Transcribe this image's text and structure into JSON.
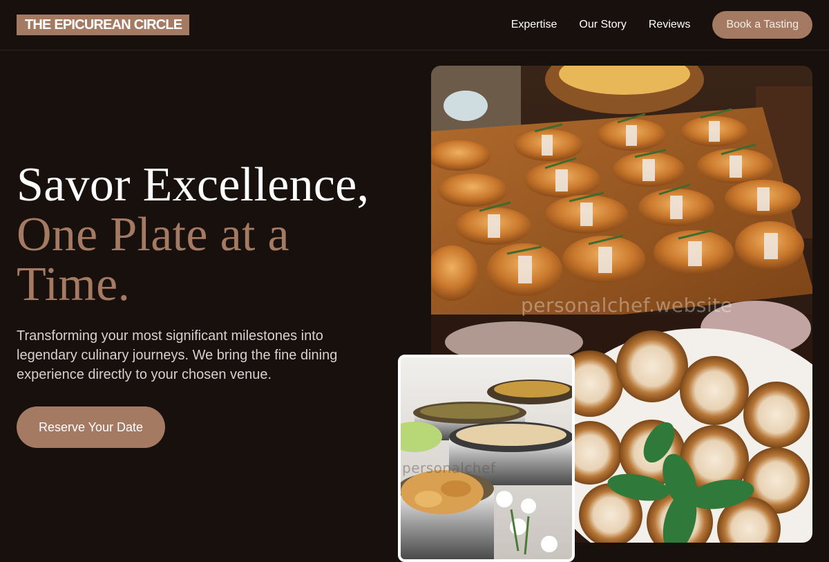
{
  "brand": {
    "name": "THE EPICUREAN CIRCLE"
  },
  "nav": {
    "links": [
      "Expertise",
      "Our Story",
      "Reviews"
    ],
    "cta": "Book a Tasting"
  },
  "hero": {
    "title_line1": "Savor Excellence,",
    "title_line2": "One Plate at a Time.",
    "subtitle": "Transforming your most significant milestones into legendary culinary journeys. We bring the fine dining experience directly to your chosen venue.",
    "cta": "Reserve Your Date"
  },
  "images": {
    "main_watermark": "personalchef.website",
    "inset_watermark": "personalchef"
  },
  "colors": {
    "background": "#17100d",
    "accent": "#a57a63",
    "text": "#ffffff",
    "muted_text": "#d7d0cc"
  }
}
